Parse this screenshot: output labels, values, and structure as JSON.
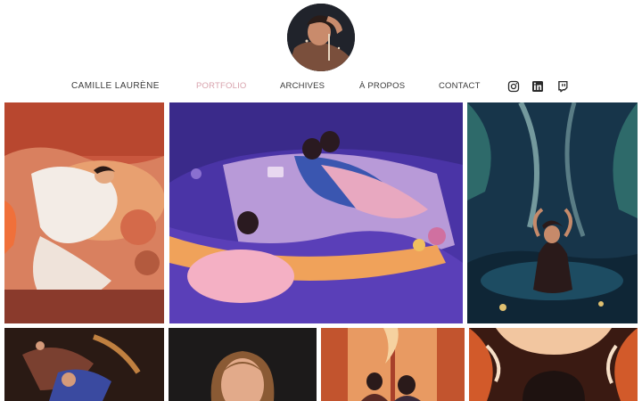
{
  "nav": {
    "brand": "CAMILLE LAURÈNE",
    "items": [
      {
        "label": "PORTFOLIO",
        "active": true
      },
      {
        "label": "ARCHIVES",
        "active": false
      },
      {
        "label": "À PROPOS",
        "active": false
      },
      {
        "label": "CONTACT",
        "active": false
      }
    ]
  },
  "social": [
    {
      "icon": "instagram-icon"
    },
    {
      "icon": "linkedin-icon"
    },
    {
      "icon": "twitch-icon"
    }
  ],
  "colors": {
    "accent": "#d8a2ac",
    "text": "#3a3a3a",
    "background": "#ffffff"
  }
}
